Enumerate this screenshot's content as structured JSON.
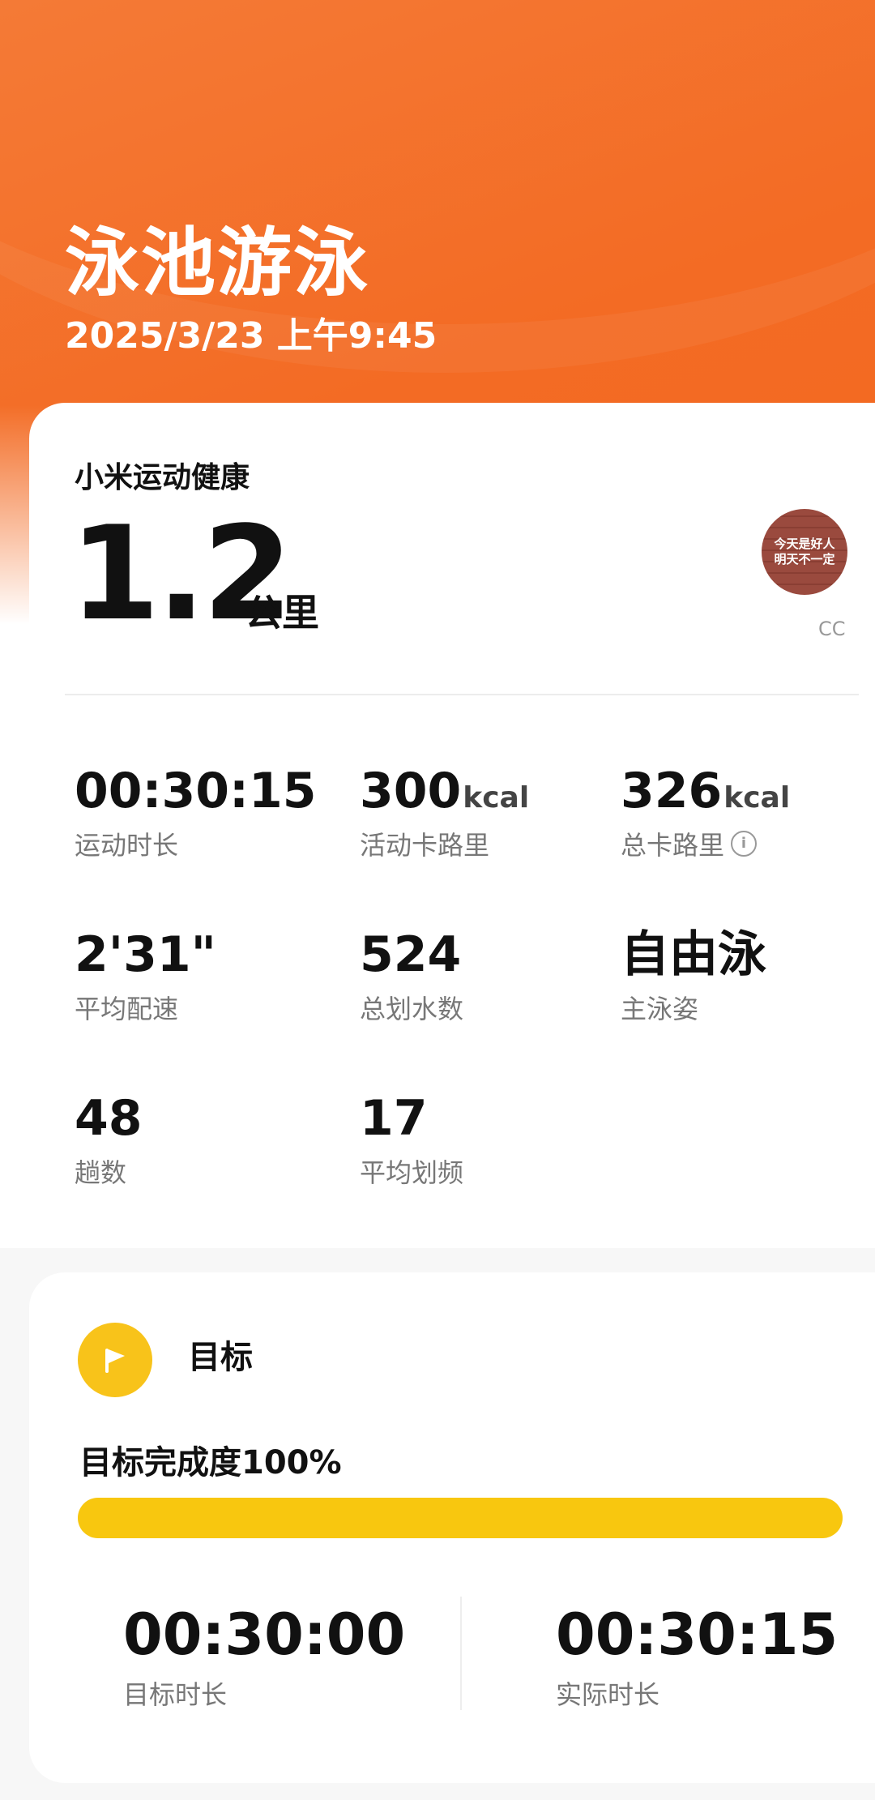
{
  "header": {
    "title": "泳池游泳",
    "datetime": "2025/3/23 上午9:45"
  },
  "summary": {
    "brand": "小米运动健康",
    "distance_value": "1.2",
    "distance_unit": "公里",
    "avatar_text_line1": "今天是好人",
    "avatar_text_line2": "明天不一定",
    "avatar_name": "CC"
  },
  "stats": [
    {
      "value": "00:30:15",
      "unit": "",
      "label": "运动时长"
    },
    {
      "value": "300",
      "unit": "kcal",
      "label": "活动卡路里"
    },
    {
      "value": "326",
      "unit": "kcal",
      "label": "总卡路里",
      "info_icon": "info-icon"
    },
    {
      "value": "2'31\"",
      "unit": "",
      "label": "平均配速"
    },
    {
      "value": "524",
      "unit": "",
      "label": "总划水数"
    },
    {
      "value": "自由泳",
      "unit": "",
      "label": "主泳姿"
    },
    {
      "value": "48",
      "unit": "",
      "label": "趟数"
    },
    {
      "value": "17",
      "unit": "",
      "label": "平均划频"
    }
  ],
  "goal": {
    "icon": "flag-icon",
    "title": "目标",
    "completion_text": "目标完成度100%",
    "progress_fraction": 1.0,
    "target_value": "00:30:00",
    "target_label": "目标时长",
    "actual_value": "00:30:15",
    "actual_label": "实际时长"
  },
  "colors": {
    "accent_orange": "#f36b24",
    "goal_yellow": "#f8c70f"
  }
}
